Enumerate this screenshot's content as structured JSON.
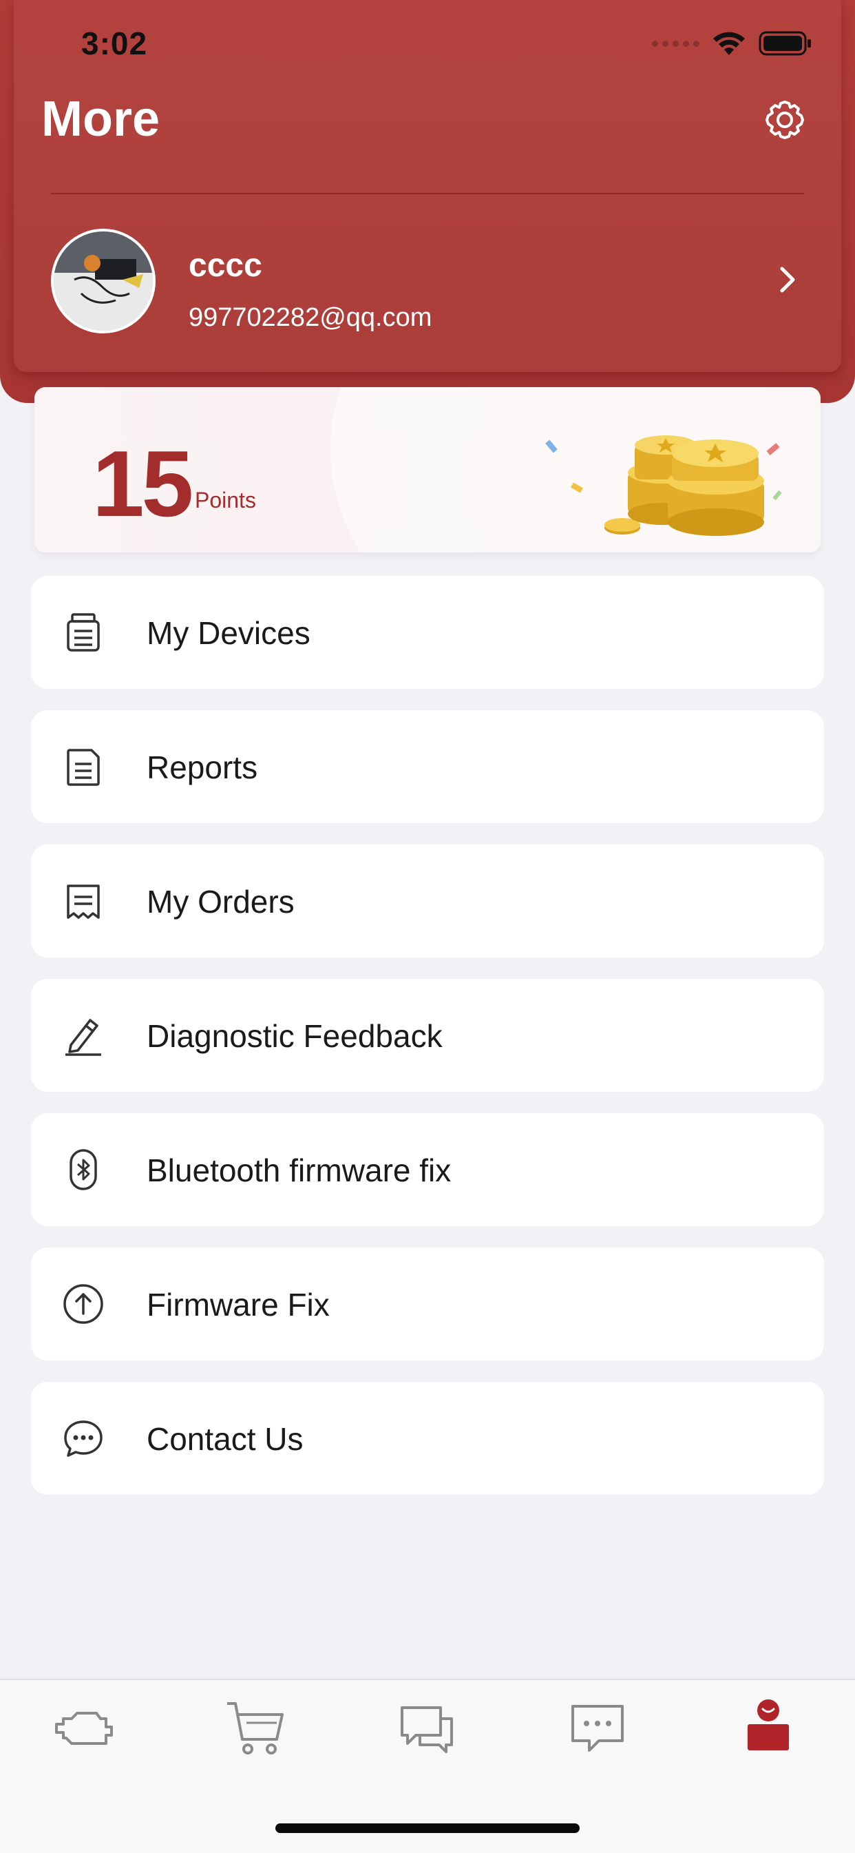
{
  "status_bar": {
    "time": "3:02"
  },
  "header": {
    "title": "More",
    "settings_icon": "gear-icon"
  },
  "profile": {
    "name": "cccc",
    "email": "997702282@qq.com",
    "chevron_icon": "chevron-right-icon"
  },
  "points": {
    "value": "15",
    "unit": "Points"
  },
  "menu": {
    "items": [
      {
        "label": "My Devices",
        "icon": "device-icon"
      },
      {
        "label": "Reports",
        "icon": "document-icon"
      },
      {
        "label": "My Orders",
        "icon": "receipt-icon"
      },
      {
        "label": "Diagnostic Feedback",
        "icon": "pencil-icon"
      },
      {
        "label": "Bluetooth firmware fix",
        "icon": "bluetooth-icon"
      },
      {
        "label": "Firmware Fix",
        "icon": "upload-arrow-icon"
      },
      {
        "label": "Contact Us",
        "icon": "chat-bubble-icon"
      }
    ]
  },
  "tab_bar": {
    "tabs": [
      {
        "icon": "engine-icon",
        "active": false
      },
      {
        "icon": "cart-icon",
        "active": false
      },
      {
        "icon": "forum-icon",
        "active": false
      },
      {
        "icon": "message-icon",
        "active": false
      },
      {
        "icon": "profile-icon",
        "active": true
      }
    ]
  },
  "colors": {
    "brand": "#aa3b37",
    "points_text": "#a32c2c",
    "background": "#f1f1f6",
    "active_tab": "#b0242a",
    "inactive_tab": "#8a8a8a"
  }
}
